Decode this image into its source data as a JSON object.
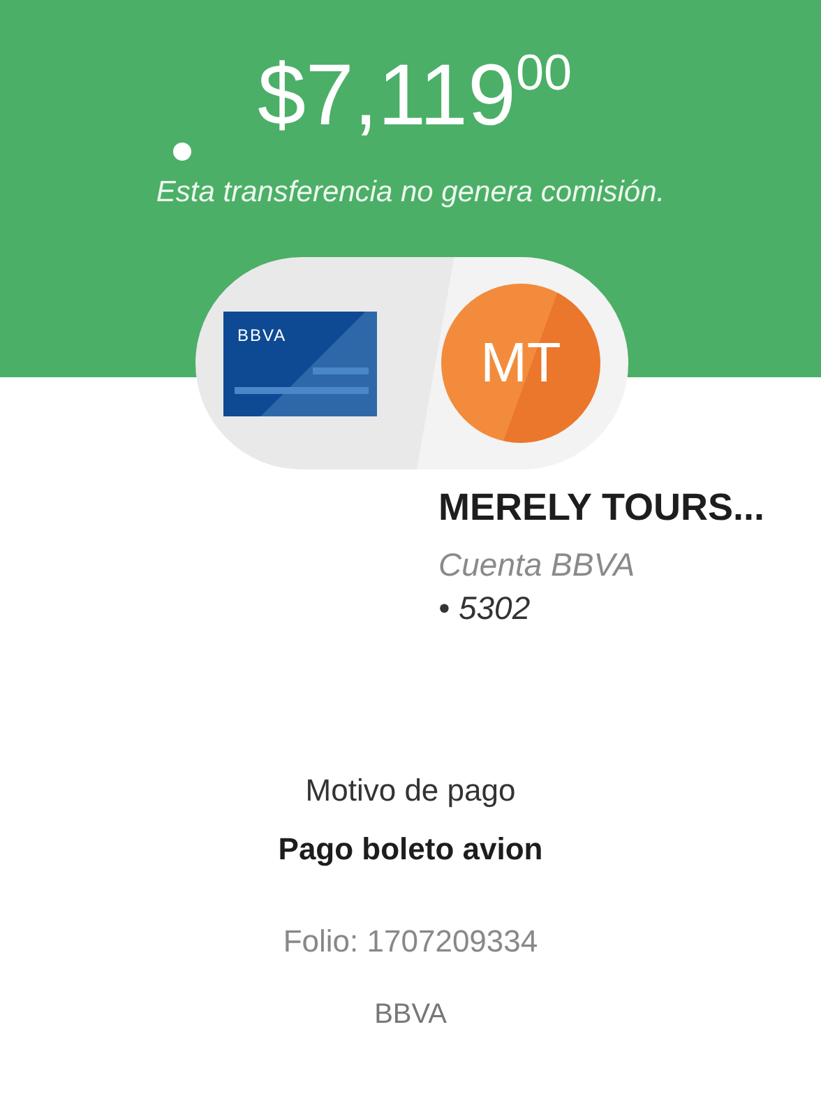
{
  "amount": {
    "main": "$7,119",
    "cents": "00"
  },
  "note": "Esta transferencia no genera comisión.",
  "origin_card": {
    "bank": "BBVA"
  },
  "recipient": {
    "initials": "MT",
    "name": "MERELY TOURS...",
    "account_type": "Cuenta BBVA",
    "account_number": "• 5302"
  },
  "motive": {
    "label": "Motivo de pago",
    "value": "Pago boleto avion"
  },
  "folio": "Folio: 1707209334",
  "bank": "BBVA"
}
